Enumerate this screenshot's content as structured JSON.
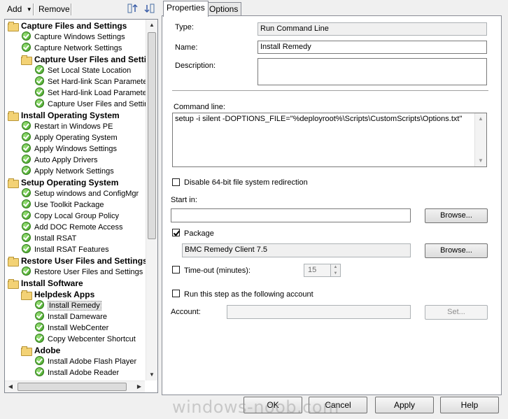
{
  "toolbar": {
    "add_label": "Add",
    "remove_label": "Remove"
  },
  "tree": {
    "items": [
      {
        "label": "Capture Files and Settings",
        "type": "group"
      },
      {
        "label": "Capture Windows Settings",
        "type": "step"
      },
      {
        "label": "Capture Network Settings",
        "type": "step"
      },
      {
        "label": "Capture User Files and Setti",
        "type": "group"
      },
      {
        "label": "Set Local State Location",
        "type": "step"
      },
      {
        "label": "Set Hard-link Scan Paramete",
        "type": "step"
      },
      {
        "label": "Set Hard-link Load Paramete",
        "type": "step"
      },
      {
        "label": "Capture User Files and Settir",
        "type": "step"
      },
      {
        "label": "Install Operating System",
        "type": "group"
      },
      {
        "label": "Restart in Windows PE",
        "type": "step"
      },
      {
        "label": "Apply Operating System",
        "type": "step"
      },
      {
        "label": "Apply Windows Settings",
        "type": "step"
      },
      {
        "label": "Auto Apply Drivers",
        "type": "step"
      },
      {
        "label": "Apply Network Settings",
        "type": "step"
      },
      {
        "label": "Setup Operating System",
        "type": "group"
      },
      {
        "label": "Setup windows and ConfigMgr",
        "type": "step"
      },
      {
        "label": "Use Toolkit Package",
        "type": "step"
      },
      {
        "label": "Copy Local Group Policy",
        "type": "step"
      },
      {
        "label": "Add DOC Remote Access",
        "type": "step"
      },
      {
        "label": "Install RSAT",
        "type": "step"
      },
      {
        "label": "Install RSAT Features",
        "type": "step"
      },
      {
        "label": "Restore User Files and Settings",
        "type": "group"
      },
      {
        "label": "Restore User Files and Settings",
        "type": "step"
      },
      {
        "label": "Install Software",
        "type": "group"
      },
      {
        "label": "Helpdesk Apps",
        "type": "group"
      },
      {
        "label": "Install Remedy",
        "type": "step"
      },
      {
        "label": "Install Dameware",
        "type": "step"
      },
      {
        "label": "Install WebCenter",
        "type": "step"
      },
      {
        "label": "Copy Webcenter Shortcut",
        "type": "step"
      },
      {
        "label": "Adobe",
        "type": "group"
      },
      {
        "label": "Install Adobe Flash Player",
        "type": "step"
      },
      {
        "label": "Install Adobe Reader",
        "type": "step"
      }
    ]
  },
  "tabs": {
    "properties": "Properties",
    "options": "Options"
  },
  "form": {
    "type_label": "Type:",
    "type_value": "Run Command Line",
    "name_label": "Name:",
    "name_value": "Install Remedy",
    "description_label": "Description:",
    "description_value": "",
    "command_line_label": "Command line:",
    "command_line_value": "setup -i silent -DOPTIONS_FILE=\"%deployroot%\\Scripts\\CustomScripts\\Options.txt\"",
    "disable_64bit_label": "Disable 64-bit file system redirection",
    "start_in_label": "Start in:",
    "start_in_value": "",
    "browse_label": "Browse...",
    "package_label": "Package",
    "package_value": "BMC Remedy Client 7.5",
    "timeout_label": "Time-out (minutes):",
    "timeout_value": "15",
    "run_as_label": "Run this step as the following account",
    "account_label": "Account:",
    "account_value": "",
    "set_label": "Set..."
  },
  "footer": {
    "ok": "OK",
    "cancel": "Cancel",
    "apply": "Apply",
    "help": "Help"
  },
  "watermark": "windows-noob.com"
}
